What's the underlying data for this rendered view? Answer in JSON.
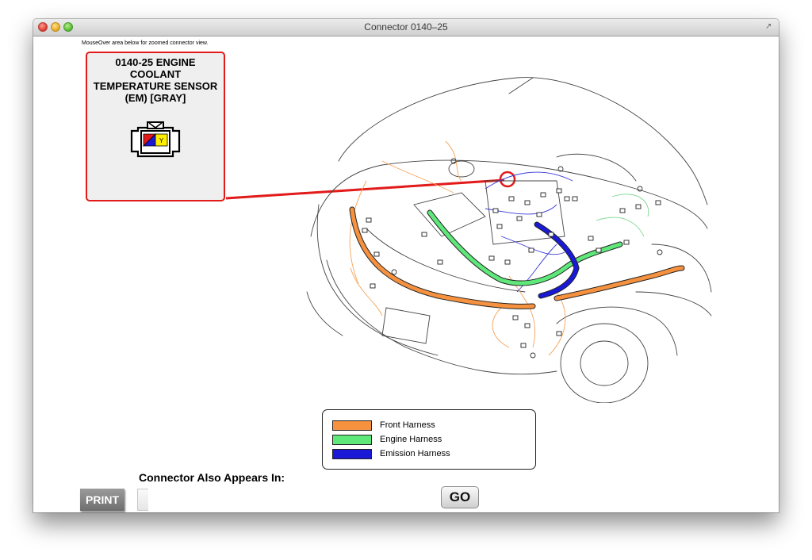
{
  "window": {
    "title": "Connector 0140–25"
  },
  "hint": "MouseOver area below for zoomed connector view.",
  "callout": {
    "title": "0140-25 ENGINE COOLANT TEMPERATURE SENSOR (EM) [GRAY]",
    "pin_label": "Y"
  },
  "legend": {
    "items": [
      {
        "label": "Front Harness",
        "color": "#f5913f"
      },
      {
        "label": "Engine Harness",
        "color": "#5fe87a"
      },
      {
        "label": "Emission Harness",
        "color": "#1a1ad6"
      }
    ]
  },
  "also_appears": {
    "label": "Connector Also Appears In:"
  },
  "buttons": {
    "print": "PRINT",
    "go": "GO"
  },
  "colors": {
    "highlight": "#e21a1a",
    "front": "#f5913f",
    "engine": "#5fe87a",
    "emission": "#1a1ad6"
  }
}
